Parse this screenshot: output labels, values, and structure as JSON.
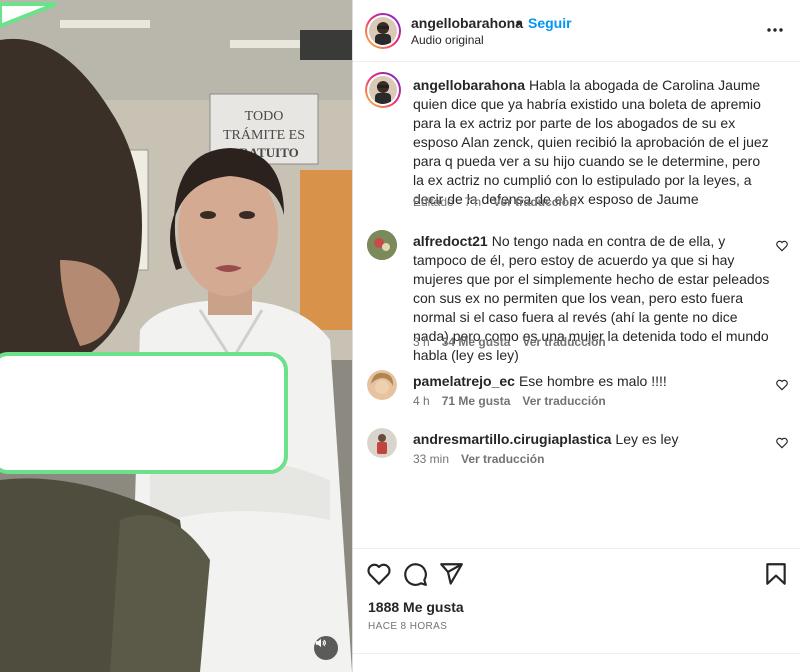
{
  "post": {
    "username": "angellobarahona",
    "separator": "•",
    "follow_label": "Seguir",
    "audio_label": "Audio original",
    "caption": "Habla la abogada de Carolina Jaume quien dice que ya habría existido una boleta de apremio para la ex actriz por parte de los abogados de su ex esposo Alan zenck, quien recibió la aprobación de el juez para q pueda ver a su hijo cuando se le determine, pero la ex actriz no cumplió con lo estipulado por la leyes, a decir de la defensa de el ex esposo de Jaume",
    "caption_edited": "Editado · 7 h",
    "translate_label": "Ver traducción",
    "likes": "1888 Me gusta",
    "time_ago": "HACE 8 HORAS"
  },
  "video_text": {
    "sign_line1": "TODO",
    "sign_line2": "TRÁMITE ES",
    "sign_line3": "GRATUITO"
  },
  "comments": [
    {
      "username": "alfredoct21",
      "text": "No tengo nada en contra de de ella, y tampoco de él, pero estoy de acuerdo ya que si hay mujeres que por el simplemente hecho de estar peleados con sus ex no permiten que los vean, pero esto fuera normal si el caso fuera al revés (ahí la gente no dice nada) pero como es una mujer la detenida todo el mundo habla (ley es ley)",
      "time": "3 h",
      "likes": "34 Me gusta",
      "translate": "Ver traducción"
    },
    {
      "username": "pamelatrejo_ec",
      "text": "Ese hombre es malo !!!!",
      "time": "4 h",
      "likes": "71 Me gusta",
      "translate": "Ver traducción"
    },
    {
      "username": "andresmartillo.cirugiaplastica",
      "text": "Ley es ley",
      "time": "33 min",
      "translate": "Ver traducción"
    }
  ],
  "icons": [
    "more-icon",
    "heart-icon",
    "comment-icon",
    "share-icon",
    "bookmark-icon",
    "volume-icon"
  ],
  "colors": {
    "link": "#0095f6",
    "muted": "#737373",
    "text": "#262626",
    "bubble_border": "#6de08a"
  }
}
